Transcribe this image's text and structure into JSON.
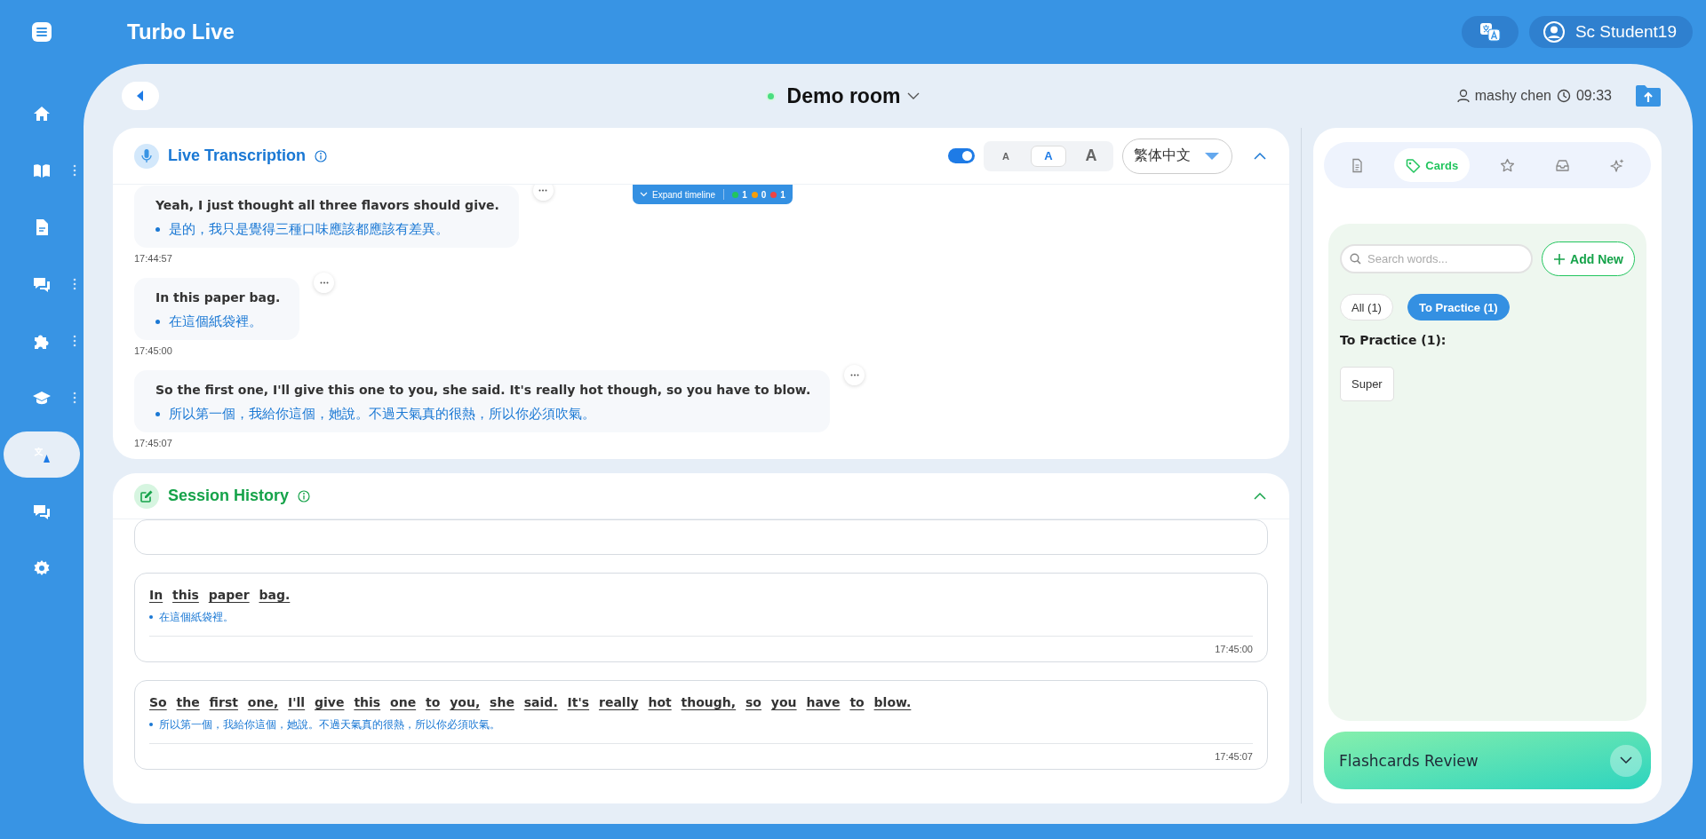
{
  "app": {
    "title": "Turbo Live",
    "user": "Sc Student19"
  },
  "sidebar": {
    "items": [
      {
        "kind": "home",
        "selected": false,
        "has_menu": false
      },
      {
        "kind": "book",
        "selected": false,
        "has_menu": true
      },
      {
        "kind": "document",
        "selected": false,
        "has_menu": false
      },
      {
        "kind": "chat",
        "selected": false,
        "has_menu": true
      },
      {
        "kind": "puzzle",
        "selected": false,
        "has_menu": true
      },
      {
        "kind": "graduation",
        "selected": false,
        "has_menu": true
      },
      {
        "kind": "translate",
        "selected": true,
        "has_menu": false
      },
      {
        "kind": "chat",
        "selected": false,
        "has_menu": false
      },
      {
        "kind": "gear",
        "selected": false,
        "has_menu": false
      }
    ]
  },
  "room": {
    "title": "Demo room",
    "live": true,
    "host": "mashy chen",
    "time": "09:33"
  },
  "live_transcription": {
    "title": "Live Transcription",
    "expanded": true,
    "captions_on": true,
    "font_sizes": [
      {
        "label": "A",
        "selected": false
      },
      {
        "label": "A",
        "selected": true
      },
      {
        "label": "A",
        "selected": false
      }
    ],
    "language": "繁体中文",
    "timeline": {
      "label": "Expand timeline",
      "counts": [
        {
          "value": "1",
          "color": "#22c55e"
        },
        {
          "value": "0",
          "color": "#f59e0b"
        },
        {
          "value": "1",
          "color": "#ef4444"
        }
      ]
    },
    "entries": [
      {
        "text": "Yeah, I just thought all three flavors should give.",
        "translation": "是的，我只是覺得三種口味應該都應該有差異。",
        "time": "17:44:57"
      },
      {
        "text": "In this paper bag.",
        "translation": "在這個紙袋裡。",
        "time": "17:45:00"
      },
      {
        "text": "So the first one, I'll give this one to you, she said. It's really hot though, so you have to blow.",
        "translation": "所以第一個，我給你這個，她說。不過天氣真的很熱，所以你必須吹氣。",
        "time": "17:45:07"
      }
    ]
  },
  "session_history": {
    "title": "Session History",
    "expanded": true,
    "card_above": true,
    "entries": [
      {
        "text": "In this paper bag.",
        "translation": "在這個紙袋裡。",
        "time": "17:45:00"
      },
      {
        "text": "So the first one, I'll give this one to you, she said. It's really hot though, so you have to blow.",
        "translation": "所以第一個，我給你這個，她說。不過天氣真的很熱，所以你必須吹氣。",
        "time": "17:45:07"
      }
    ]
  },
  "tools": {
    "tabs": [
      {
        "kind": "notes",
        "selected": false
      },
      {
        "kind": "cards",
        "label": "Cards",
        "selected": true
      },
      {
        "kind": "star",
        "selected": false
      },
      {
        "kind": "inbox",
        "selected": false
      },
      {
        "kind": "sparkle",
        "selected": false
      }
    ],
    "search": {
      "placeholder": "Search words..."
    },
    "add_button": "Add New",
    "filters": [
      {
        "label": "All (1)",
        "selected": false
      },
      {
        "label": "To Practice (1)",
        "selected": true
      }
    ],
    "heading": "To Practice (1):",
    "words": [
      "Super"
    ],
    "flashcards": {
      "title": "Flashcards Review",
      "expanded": false
    }
  }
}
